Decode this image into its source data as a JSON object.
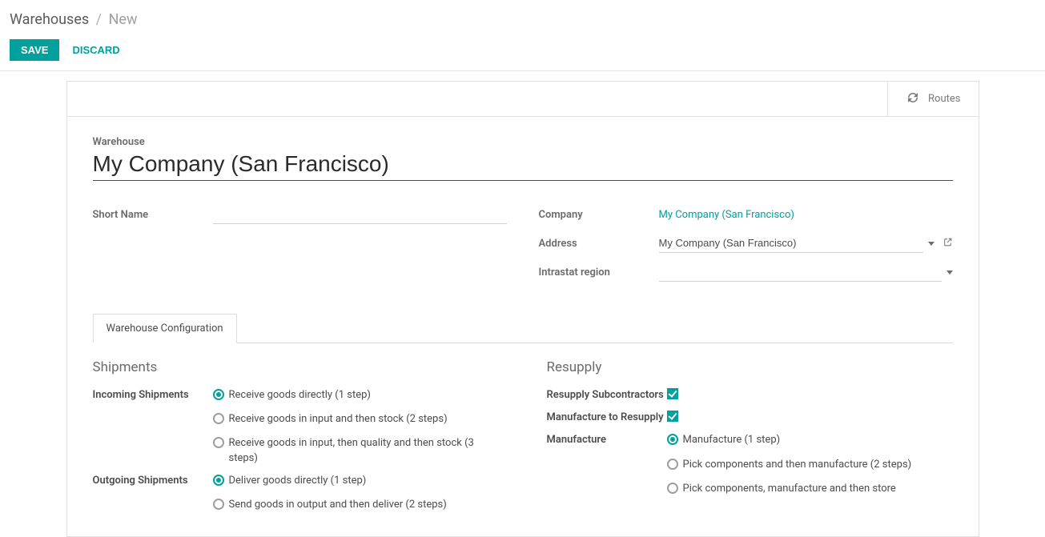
{
  "breadcrumb": {
    "root": "Warehouses",
    "current": "New"
  },
  "buttons": {
    "save": "SAVE",
    "discard": "DISCARD"
  },
  "statbox": {
    "routes": "Routes"
  },
  "title": {
    "label": "Warehouse",
    "value": "My Company (San Francisco)"
  },
  "left": {
    "short_name_label": "Short Name",
    "short_name_value": ""
  },
  "right": {
    "company_label": "Company",
    "company_value": "My Company (San Francisco)",
    "address_label": "Address",
    "address_value": "My Company (San Francisco)",
    "intrastat_label": "Intrastat region",
    "intrastat_value": ""
  },
  "tabs": {
    "config": "Warehouse Configuration"
  },
  "shipments": {
    "title": "Shipments",
    "incoming_label": "Incoming Shipments",
    "incoming_opts": [
      "Receive goods directly (1 step)",
      "Receive goods in input and then stock (2 steps)",
      "Receive goods in input, then quality and then stock (3 steps)"
    ],
    "outgoing_label": "Outgoing Shipments",
    "outgoing_opts": [
      "Deliver goods directly (1 step)",
      "Send goods in output and then deliver (2 steps)"
    ]
  },
  "resupply": {
    "title": "Resupply",
    "subcontractors_label": "Resupply Subcontractors",
    "mfg_to_resupply_label": "Manufacture to Resupply",
    "manufacture_label": "Manufacture",
    "manufacture_opts": [
      "Manufacture (1 step)",
      "Pick components and then manufacture (2 steps)",
      "Pick components, manufacture and then store"
    ]
  }
}
